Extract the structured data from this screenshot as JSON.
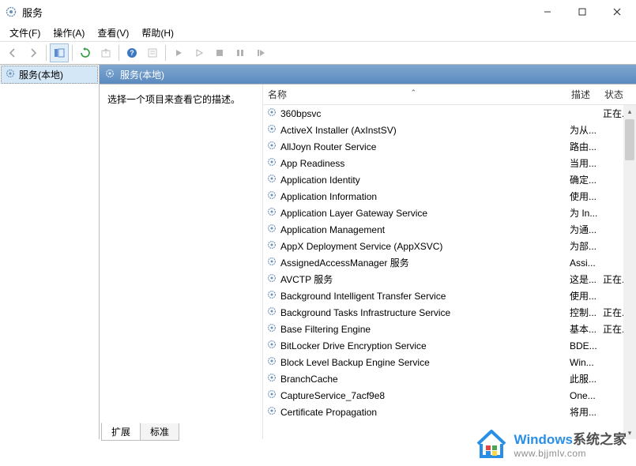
{
  "window": {
    "title": "服务",
    "min": "—",
    "max": "☐",
    "close": "✕"
  },
  "menu": {
    "file": "文件(F)",
    "action": "操作(A)",
    "view": "查看(V)",
    "help": "帮助(H)"
  },
  "tree": {
    "root": "服务(本地)"
  },
  "pane_header": "服务(本地)",
  "desc_prompt": "选择一个项目来查看它的描述。",
  "columns": {
    "name": "名称",
    "desc": "描述",
    "status": "状态"
  },
  "services": [
    {
      "name": "360bpsvc",
      "desc": "",
      "status": "正在..."
    },
    {
      "name": "ActiveX Installer (AxInstSV)",
      "desc": "为从...",
      "status": ""
    },
    {
      "name": "AllJoyn Router Service",
      "desc": "路由...",
      "status": ""
    },
    {
      "name": "App Readiness",
      "desc": "当用...",
      "status": ""
    },
    {
      "name": "Application Identity",
      "desc": "确定...",
      "status": ""
    },
    {
      "name": "Application Information",
      "desc": "使用...",
      "status": ""
    },
    {
      "name": "Application Layer Gateway Service",
      "desc": "为 In...",
      "status": ""
    },
    {
      "name": "Application Management",
      "desc": "为通...",
      "status": ""
    },
    {
      "name": "AppX Deployment Service (AppXSVC)",
      "desc": "为部...",
      "status": ""
    },
    {
      "name": "AssignedAccessManager 服务",
      "desc": "Assi...",
      "status": ""
    },
    {
      "name": "AVCTP 服务",
      "desc": "这是...",
      "status": "正在..."
    },
    {
      "name": "Background Intelligent Transfer Service",
      "desc": "使用...",
      "status": ""
    },
    {
      "name": "Background Tasks Infrastructure Service",
      "desc": "控制...",
      "status": "正在..."
    },
    {
      "name": "Base Filtering Engine",
      "desc": "基本...",
      "status": "正在..."
    },
    {
      "name": "BitLocker Drive Encryption Service",
      "desc": "BDE...",
      "status": ""
    },
    {
      "name": "Block Level Backup Engine Service",
      "desc": "Win...",
      "status": ""
    },
    {
      "name": "BranchCache",
      "desc": "此服...",
      "status": ""
    },
    {
      "name": "CaptureService_7acf9e8",
      "desc": "One...",
      "status": ""
    },
    {
      "name": "Certificate Propagation",
      "desc": "将用...",
      "status": ""
    }
  ],
  "tabs": {
    "extended": "扩展",
    "standard": "标准"
  },
  "watermark": {
    "brand1": "Windows",
    "brand2": "系统之家",
    "url": "www.bjjmlv.com"
  }
}
